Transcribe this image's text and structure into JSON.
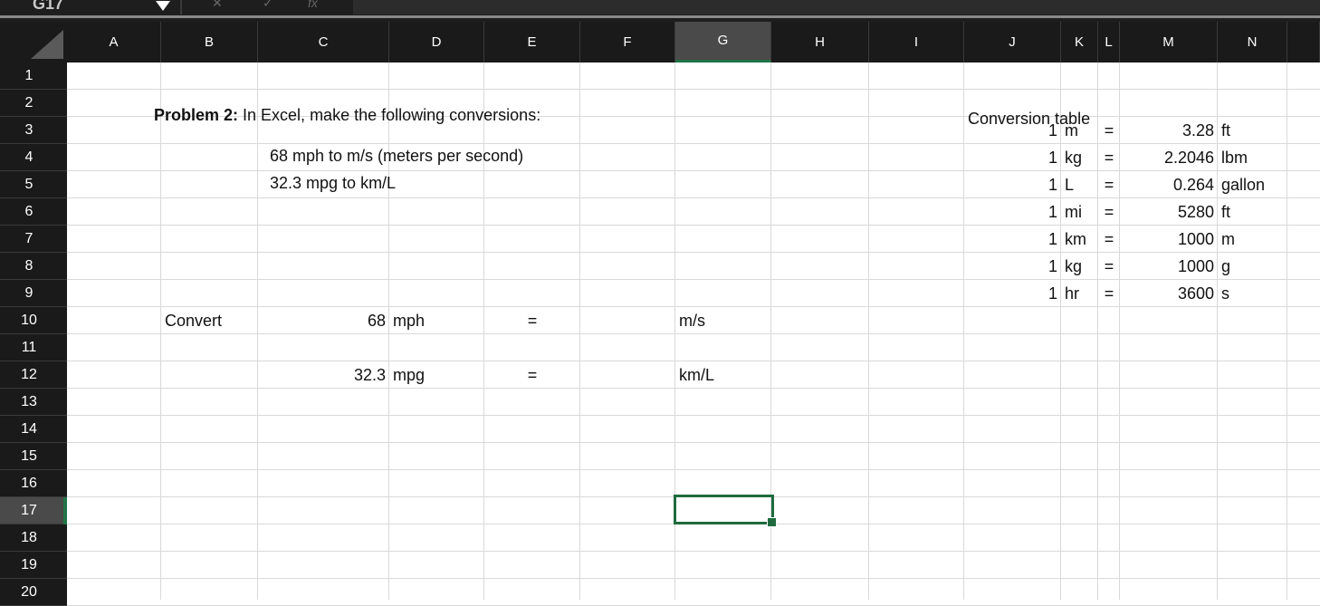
{
  "formula_bar": {
    "name_box": "G17",
    "fx_label": "fx"
  },
  "columns": [
    "A",
    "B",
    "C",
    "D",
    "E",
    "F",
    "G",
    "H",
    "I",
    "J",
    "K",
    "L",
    "M",
    "N"
  ],
  "rows": [
    "1",
    "2",
    "3",
    "4",
    "5",
    "6",
    "7",
    "8",
    "9",
    "10",
    "11",
    "12",
    "13",
    "14",
    "15",
    "16",
    "17",
    "18",
    "19",
    "20"
  ],
  "active_cell": "G17",
  "sheet": {
    "problem_bold": "Problem 2:",
    "problem_text": " In Excel, make the following conversions:",
    "task1": "68 mph to m/s (meters per second)",
    "task2": "32.3 mpg to km/L",
    "convert_label": "Convert",
    "row10": {
      "value": "68",
      "unit": "mph",
      "eq": "=",
      "target": "m/s"
    },
    "row12": {
      "value": "32.3",
      "unit": "mpg",
      "eq": "=",
      "target": "km/L"
    },
    "conversion_table": {
      "title": "Conversion table",
      "rows": [
        {
          "qty": "1",
          "from": "m",
          "eq": "=",
          "value": "3.28",
          "to": "ft"
        },
        {
          "qty": "1",
          "from": "kg",
          "eq": "=",
          "value": "2.2046",
          "to": "lbm"
        },
        {
          "qty": "1",
          "from": "L",
          "eq": "=",
          "value": "0.264",
          "to": "gallon"
        },
        {
          "qty": "1",
          "from": "mi",
          "eq": "=",
          "value": "5280",
          "to": "ft"
        },
        {
          "qty": "1",
          "from": "km",
          "eq": "=",
          "value": "1000",
          "to": "m"
        },
        {
          "qty": "1",
          "from": "kg",
          "eq": "=",
          "value": "1000",
          "to": "g"
        },
        {
          "qty": "1",
          "from": "hr",
          "eq": "=",
          "value": "3600",
          "to": "s"
        }
      ]
    }
  }
}
